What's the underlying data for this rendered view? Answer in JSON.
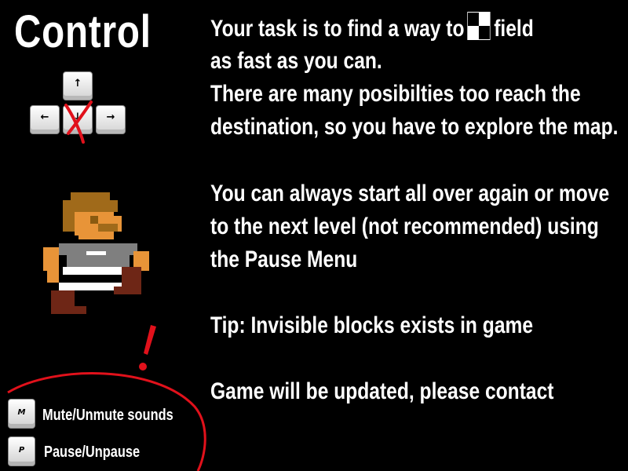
{
  "title": "Control",
  "arrow_keys": {
    "up": "↑",
    "left": "←",
    "down": "↓",
    "right": "→"
  },
  "instructions": {
    "line1_before_icon": "Your task is to find a way to",
    "line1_after_icon": "field",
    "line2": "as fast as you can.",
    "line3": "There are many posibilties too reach the",
    "line4": "destination, so you have to explore the map.",
    "line5": "You can always start all over again or move",
    "line6": "to the next level (not recommended) using",
    "line7": "the Pause Menu",
    "tip": "Tip: Invisible blocks exists in game",
    "update": "Game will be updated, please contact"
  },
  "legend": [
    {
      "key": "M",
      "label": "Mute/Unmute sounds"
    },
    {
      "key": "P",
      "label": "Pause/Unpause"
    }
  ],
  "colors": {
    "background": "#000000",
    "text": "#ffffff",
    "warning_red": "#e1111b",
    "skin": "#e89438",
    "hair": "#a06a1a",
    "shirt": "#7f7f7f",
    "stripe": "#000000",
    "boots": "#6e2616"
  },
  "icons": {
    "finish": "checkered-flag-field",
    "disabled_key": "red-x-mark",
    "warning": "exclamation-mark"
  }
}
